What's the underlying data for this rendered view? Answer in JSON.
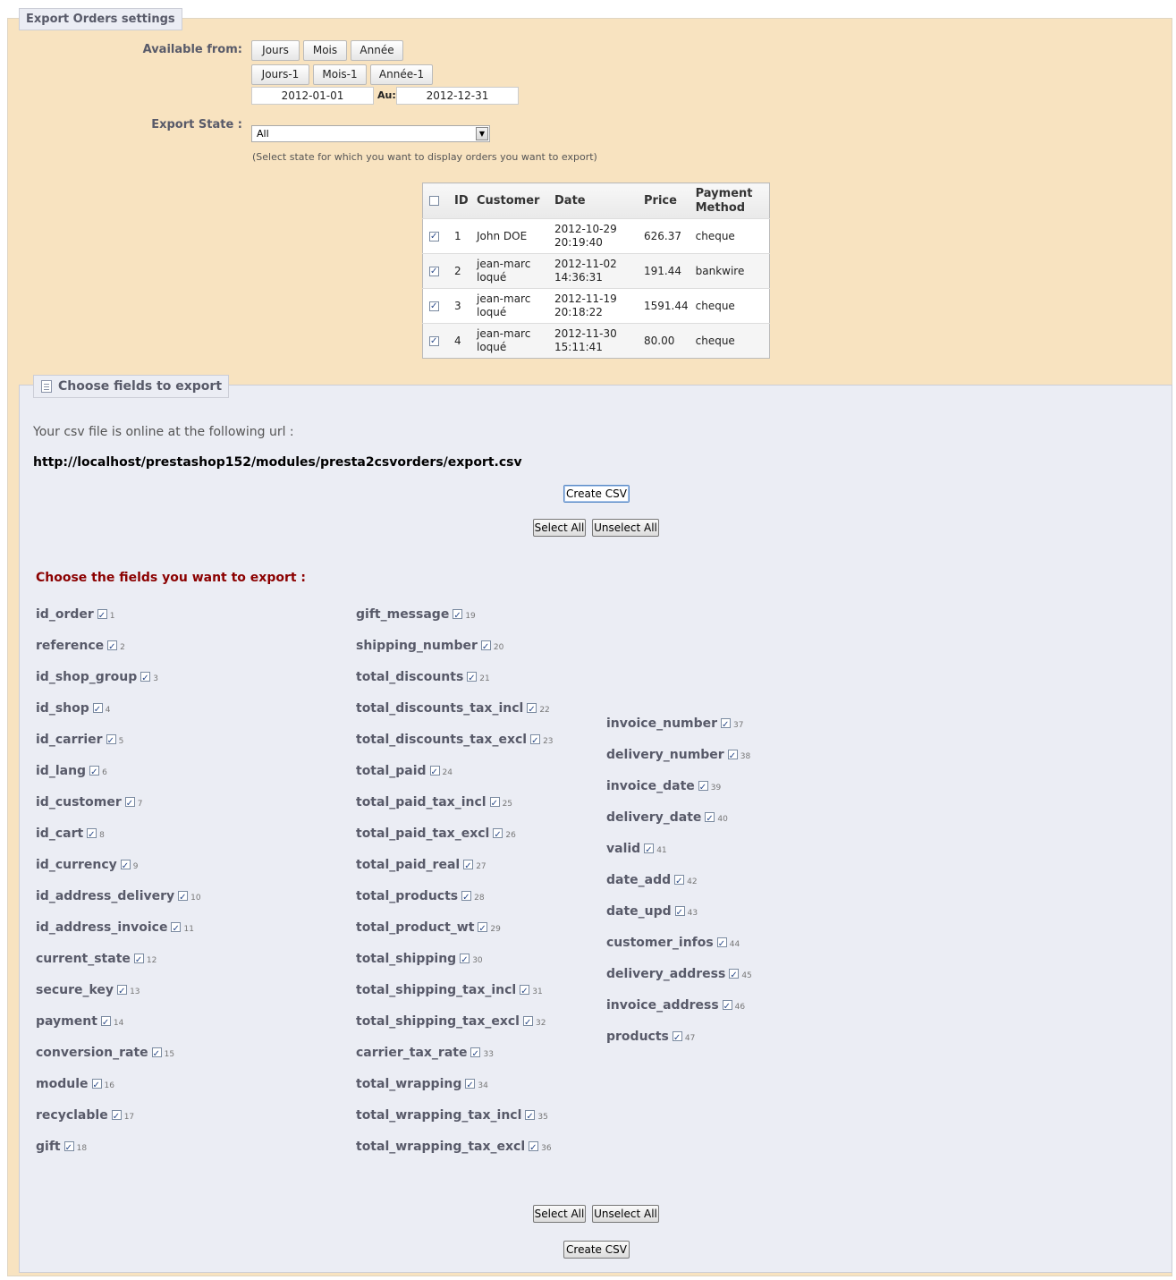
{
  "settings": {
    "title": "Export Orders settings",
    "available_from_label": "Available from:",
    "range_buttons": [
      "Jours",
      "Mois",
      "Année"
    ],
    "prev_range_buttons": [
      "Jours-1",
      "Mois-1",
      "Année-1"
    ],
    "date_from": "2012-01-01",
    "date_to_label": "Au:",
    "date_to": "2012-12-31",
    "export_state_label": "Export State :",
    "export_state_value": "All",
    "export_state_hint": "(Select state for which you want to display orders you want to export)"
  },
  "orders": {
    "columns": [
      "ID",
      "Customer",
      "Date",
      "Price",
      "Payment Method"
    ],
    "rows": [
      {
        "checked": true,
        "id": "1",
        "customer": "John DOE",
        "date": "2012-10-29 20:19:40",
        "price": "626.37",
        "payment": "cheque"
      },
      {
        "checked": true,
        "id": "2",
        "customer": "jean-marc loqué",
        "date": "2012-11-02 14:36:31",
        "price": "191.44",
        "payment": "bankwire"
      },
      {
        "checked": true,
        "id": "3",
        "customer": "jean-marc loqué",
        "date": "2012-11-19 20:18:22",
        "price": "1591.44",
        "payment": "cheque"
      },
      {
        "checked": true,
        "id": "4",
        "customer": "jean-marc loqué",
        "date": "2012-11-30 15:11:41",
        "price": "80.00",
        "payment": "cheque"
      }
    ]
  },
  "export": {
    "title": "Choose fields to export",
    "url_text": "Your csv file is online at the following url :",
    "url": "http://localhost/prestashop152/modules/presta2csvorders/export.csv",
    "create_csv_label": "Create CSV",
    "select_all_label": "Select All",
    "unselect_all_label": "Unselect All",
    "choose_fields_label": "Choose the fields you want to export :",
    "fields": [
      {
        "name": "id_order",
        "num": "1",
        "checked": true
      },
      {
        "name": "reference",
        "num": "2",
        "checked": true
      },
      {
        "name": "id_shop_group",
        "num": "3",
        "checked": true
      },
      {
        "name": "id_shop",
        "num": "4",
        "checked": true
      },
      {
        "name": "id_carrier",
        "num": "5",
        "checked": true
      },
      {
        "name": "id_lang",
        "num": "6",
        "checked": true
      },
      {
        "name": "id_customer",
        "num": "7",
        "checked": true
      },
      {
        "name": "id_cart",
        "num": "8",
        "checked": true
      },
      {
        "name": "id_currency",
        "num": "9",
        "checked": true
      },
      {
        "name": "id_address_delivery",
        "num": "10",
        "checked": true
      },
      {
        "name": "id_address_invoice",
        "num": "11",
        "checked": true
      },
      {
        "name": "current_state",
        "num": "12",
        "checked": true
      },
      {
        "name": "secure_key",
        "num": "13",
        "checked": true
      },
      {
        "name": "payment",
        "num": "14",
        "checked": true
      },
      {
        "name": "conversion_rate",
        "num": "15",
        "checked": true
      },
      {
        "name": "module",
        "num": "16",
        "checked": true
      },
      {
        "name": "recyclable",
        "num": "17",
        "checked": true
      },
      {
        "name": "gift",
        "num": "18",
        "checked": true
      },
      {
        "name": "gift_message",
        "num": "19",
        "checked": true
      },
      {
        "name": "shipping_number",
        "num": "20",
        "checked": true
      },
      {
        "name": "total_discounts",
        "num": "21",
        "checked": true
      },
      {
        "name": "total_discounts_tax_incl",
        "num": "22",
        "checked": true
      },
      {
        "name": "total_discounts_tax_excl",
        "num": "23",
        "checked": true
      },
      {
        "name": "total_paid",
        "num": "24",
        "checked": true
      },
      {
        "name": "total_paid_tax_incl",
        "num": "25",
        "checked": true
      },
      {
        "name": "total_paid_tax_excl",
        "num": "26",
        "checked": true
      },
      {
        "name": "total_paid_real",
        "num": "27",
        "checked": true
      },
      {
        "name": "total_products",
        "num": "28",
        "checked": true
      },
      {
        "name": "total_product_wt",
        "num": "29",
        "checked": true
      },
      {
        "name": "total_shipping",
        "num": "30",
        "checked": true
      },
      {
        "name": "total_shipping_tax_incl",
        "num": "31",
        "checked": true
      },
      {
        "name": "total_shipping_tax_excl",
        "num": "32",
        "checked": true
      },
      {
        "name": "carrier_tax_rate",
        "num": "33",
        "checked": true
      },
      {
        "name": "total_wrapping",
        "num": "34",
        "checked": true
      },
      {
        "name": "total_wrapping_tax_incl",
        "num": "35",
        "checked": true
      },
      {
        "name": "total_wrapping_tax_excl",
        "num": "36",
        "checked": true
      },
      {
        "name": "invoice_number",
        "num": "37",
        "checked": true
      },
      {
        "name": "delivery_number",
        "num": "38",
        "checked": true
      },
      {
        "name": "invoice_date",
        "num": "39",
        "checked": true
      },
      {
        "name": "delivery_date",
        "num": "40",
        "checked": true
      },
      {
        "name": "valid",
        "num": "41",
        "checked": true
      },
      {
        "name": "date_add",
        "num": "42",
        "checked": true
      },
      {
        "name": "date_upd",
        "num": "43",
        "checked": true
      },
      {
        "name": "customer_infos",
        "num": "44",
        "checked": true
      },
      {
        "name": "delivery_address",
        "num": "45",
        "checked": true
      },
      {
        "name": "invoice_address",
        "num": "46",
        "checked": true
      },
      {
        "name": "products",
        "num": "47",
        "checked": true
      }
    ]
  }
}
